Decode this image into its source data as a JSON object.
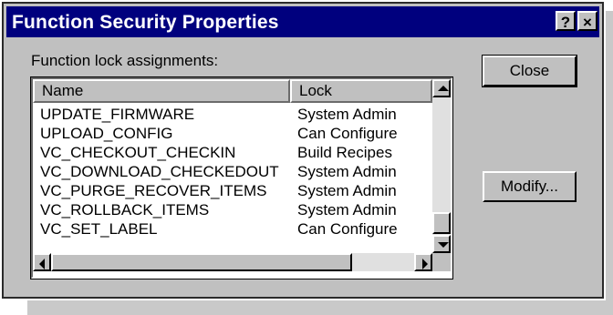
{
  "window": {
    "title": "Function Security Properties",
    "help_glyph": "?",
    "close_glyph": "×"
  },
  "list": {
    "label": "Function lock assignments:",
    "columns": {
      "name": "Name",
      "lock": "Lock"
    },
    "rows": [
      {
        "name": "UPDATE_FIRMWARE",
        "lock": "System Admin"
      },
      {
        "name": "UPLOAD_CONFIG",
        "lock": "Can Configure"
      },
      {
        "name": "VC_CHECKOUT_CHECKIN",
        "lock": "Build Recipes"
      },
      {
        "name": "VC_DOWNLOAD_CHECKEDOUT",
        "lock": "System Admin"
      },
      {
        "name": "VC_PURGE_RECOVER_ITEMS",
        "lock": "System Admin"
      },
      {
        "name": "VC_ROLLBACK_ITEMS",
        "lock": "System Admin"
      },
      {
        "name": "VC_SET_LABEL",
        "lock": "Can Configure"
      }
    ]
  },
  "buttons": {
    "close": "Close",
    "modify": "Modify..."
  },
  "colors": {
    "titlebar": "#00007e",
    "face": "#c0c0c0"
  }
}
